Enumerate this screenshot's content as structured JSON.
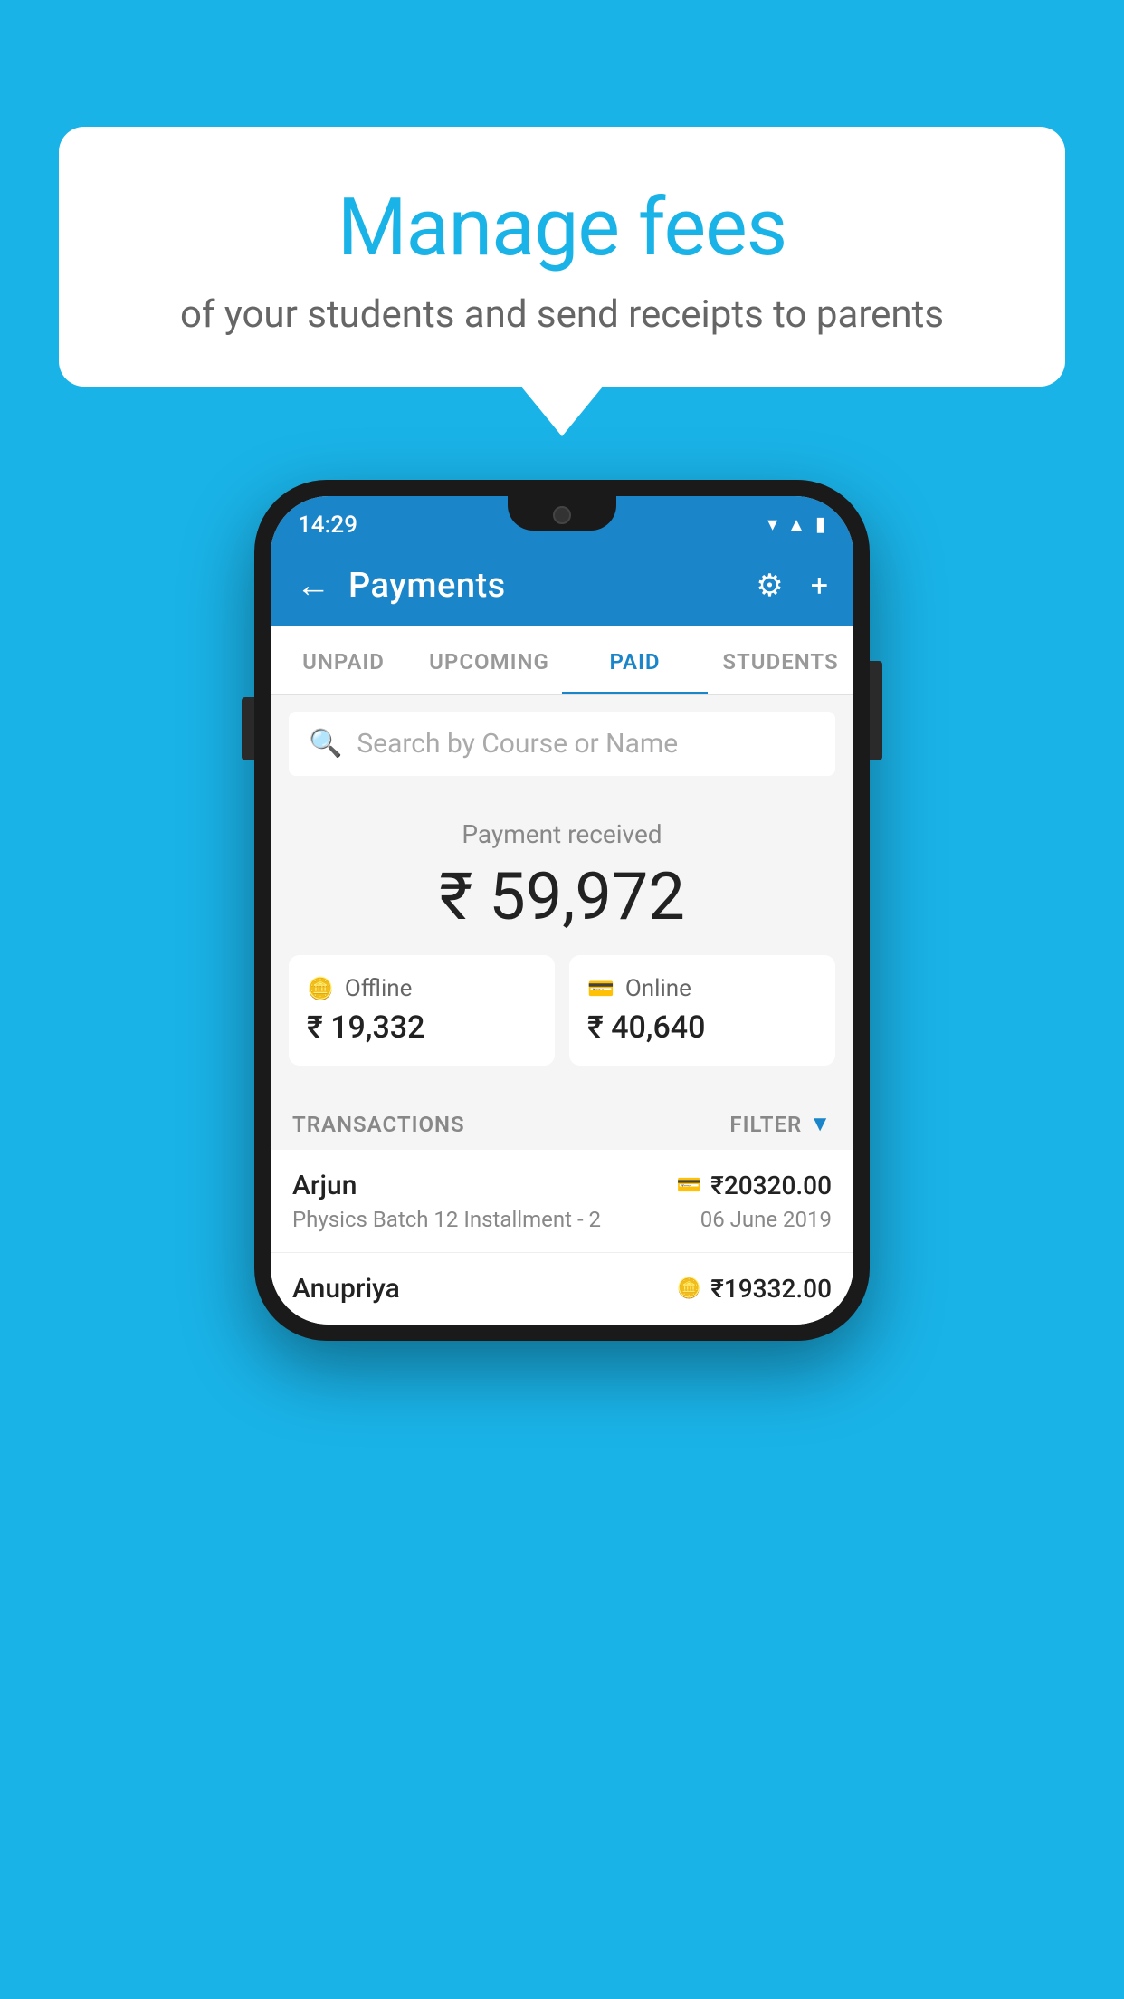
{
  "background_color": "#1ab3e8",
  "speech_bubble": {
    "title": "Manage fees",
    "subtitle": "of your students and send receipts to parents"
  },
  "phone": {
    "status_bar": {
      "time": "14:29",
      "icons": [
        "wifi",
        "signal",
        "battery"
      ]
    },
    "header": {
      "title": "Payments",
      "back_label": "←",
      "gear_label": "⚙",
      "plus_label": "+"
    },
    "tabs": [
      {
        "label": "UNPAID",
        "active": false
      },
      {
        "label": "UPCOMING",
        "active": false
      },
      {
        "label": "PAID",
        "active": true
      },
      {
        "label": "STUDENTS",
        "active": false
      }
    ],
    "search": {
      "placeholder": "Search by Course or Name"
    },
    "payment_summary": {
      "label": "Payment received",
      "amount": "₹ 59,972",
      "offline": {
        "type": "Offline",
        "amount": "₹ 19,332"
      },
      "online": {
        "type": "Online",
        "amount": "₹ 40,640"
      }
    },
    "transactions": {
      "header_label": "TRANSACTIONS",
      "filter_label": "FILTER",
      "items": [
        {
          "name": "Arjun",
          "amount": "₹20320.00",
          "detail": "Physics Batch 12 Installment - 2",
          "date": "06 June 2019",
          "payment_type": "card"
        },
        {
          "name": "Anupriya",
          "amount": "₹19332.00",
          "detail": "",
          "date": "",
          "payment_type": "cash"
        }
      ]
    }
  }
}
